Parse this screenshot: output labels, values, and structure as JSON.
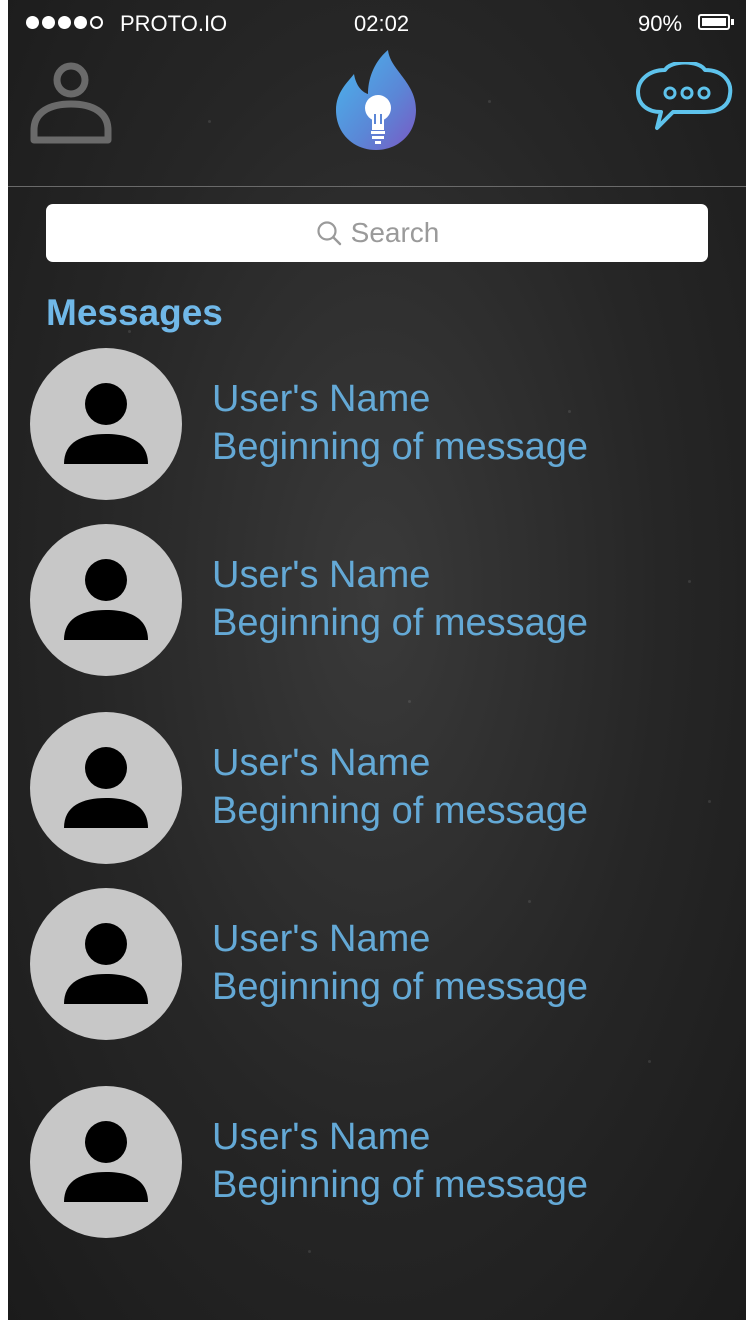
{
  "status_bar": {
    "carrier": "PROTO.IO",
    "signal_dots_filled": 4,
    "signal_dots_total": 5,
    "time": "02:02",
    "battery_percent": "90%"
  },
  "nav": {
    "left_icon": "profile-icon",
    "center_icon": "flame-lightbulb-logo",
    "right_icon": "chat-bubble-icon"
  },
  "search": {
    "placeholder": "Search"
  },
  "section_title": "Messages",
  "messages": [
    {
      "name": "User's Name",
      "preview": "Beginning of message"
    },
    {
      "name": "User's Name",
      "preview": "Beginning of message"
    },
    {
      "name": "User's Name",
      "preview": "Beginning of message"
    },
    {
      "name": "User's Name",
      "preview": "Beginning of message"
    },
    {
      "name": "User's Name",
      "preview": "Beginning of message"
    }
  ],
  "colors": {
    "background": "#262626",
    "accent_blue": "#70b8e8",
    "message_text": "#64a9d6",
    "avatar_bg": "#c7c7c7",
    "chat_icon": "#5ec3ec"
  }
}
